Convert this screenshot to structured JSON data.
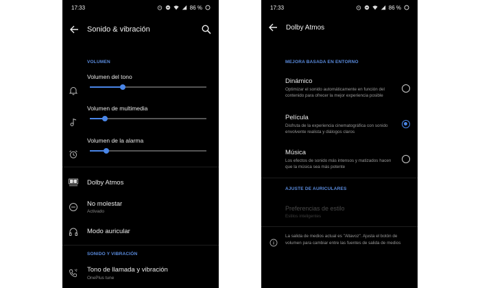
{
  "left": {
    "status": {
      "time": "17:33",
      "battery": "86 %"
    },
    "appbar": {
      "title": "Sonido & vibración"
    },
    "volume_section": "VOLUMEN",
    "volumes": [
      {
        "label": "Volumen del tono",
        "icon": "bell-icon",
        "level": 0.28
      },
      {
        "label": "Volumen de multimedia",
        "icon": "music-note-icon",
        "level": 0.13
      },
      {
        "label": "Volumen de la alarma",
        "icon": "alarm-icon",
        "level": 0.14
      }
    ],
    "items": [
      {
        "label": "Dolby Atmos",
        "sub": "",
        "icon": "dolby-icon"
      },
      {
        "label": "No molestar",
        "sub": "Activado",
        "icon": "do-not-disturb-icon"
      },
      {
        "label": "Modo auricular",
        "sub": "",
        "icon": "headphones-icon"
      }
    ],
    "sound_section": "SONIDO Y VIBRACIÓN",
    "ringtone": {
      "label": "Tono de llamada y vibración",
      "sub": "OnePlus tune"
    }
  },
  "right": {
    "status": {
      "time": "17:33",
      "battery": "86 %"
    },
    "appbar": {
      "title": "Dolby Atmos"
    },
    "env_section": "MEJORA BASADA EN ENTORNO",
    "options": [
      {
        "label": "Dinámico",
        "desc": "Optimizar el sonido automáticamente en función del contenido para ofrecer la mejor experiencia posible",
        "selected": false
      },
      {
        "label": "Película",
        "desc": "Disfruta de la experiencia cinematográfica con sonido envolvente realista y diálogos claros",
        "selected": true
      },
      {
        "label": "Música",
        "desc": "Los efectos de sonido más intensos y matizados hacen que la música sea más potente",
        "selected": false
      }
    ],
    "headphone_section": "AJUSTE DE AURICULARES",
    "style_pref": {
      "label": "Preferencias de estilo",
      "sub": "Estilos inteligentes"
    },
    "info_text": "La salida de medios actual es \"Altavoz\". Ajusta el botón de volumen para cambiar entre las fuentes de salida de medios"
  },
  "colors": {
    "accent": "#4a86e8",
    "background": "#000000"
  }
}
